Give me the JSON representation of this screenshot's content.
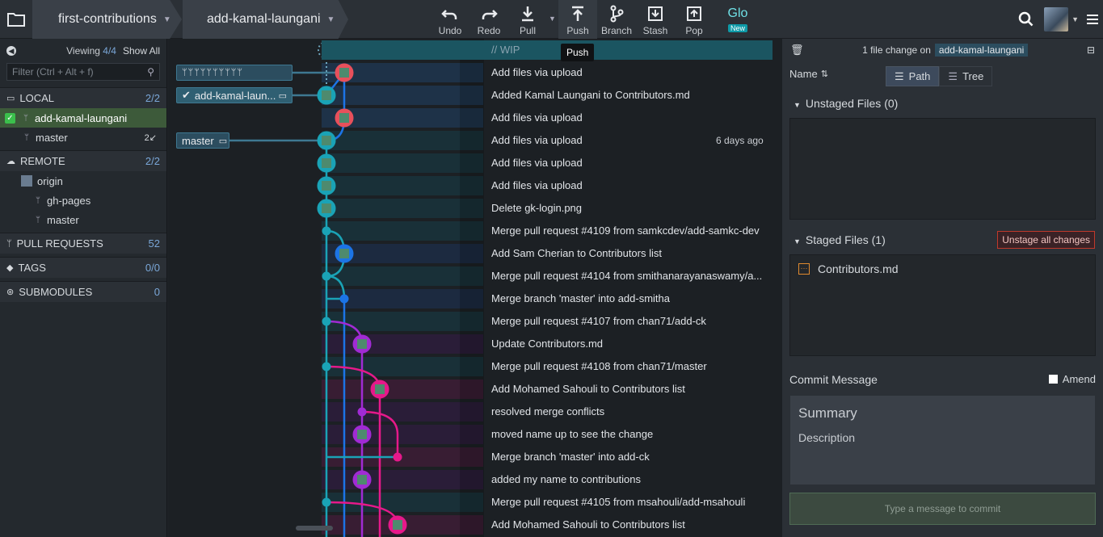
{
  "toolbar": {
    "repo": "first-contributions",
    "branch": "add-kamal-laungani",
    "buttons": [
      {
        "label": "Undo",
        "icon": "undo-icon"
      },
      {
        "label": "Redo",
        "icon": "redo-icon"
      },
      {
        "label": "Pull",
        "icon": "pull-icon"
      },
      {
        "label": "Push",
        "icon": "push-icon"
      },
      {
        "label": "Branch",
        "icon": "branch-icon"
      },
      {
        "label": "Stash",
        "icon": "stash-icon"
      },
      {
        "label": "Pop",
        "icon": "pop-icon"
      }
    ],
    "glo": "Glo",
    "glo_badge": "New",
    "tooltip": "Push"
  },
  "sidebar": {
    "viewing_label": "Viewing",
    "viewing_count": "4/4",
    "show_all": "Show All",
    "filter_placeholder": "Filter (Ctrl + Alt + f)",
    "local": {
      "label": "LOCAL",
      "count": "2/2"
    },
    "local_items": [
      {
        "label": "add-kamal-laungani",
        "badge": ""
      },
      {
        "label": "master",
        "badge": "2↙"
      }
    ],
    "remote": {
      "label": "REMOTE",
      "count": "2/2"
    },
    "remote_origin": "origin",
    "remote_items": [
      "gh-pages",
      "master"
    ],
    "pull_requests": {
      "label": "PULL REQUESTS",
      "count": "52"
    },
    "tags": {
      "label": "TAGS",
      "count": "0/0"
    },
    "submodules": {
      "label": "SUBMODULES",
      "count": "0"
    }
  },
  "graph": {
    "wip": "// WIP",
    "tags": {
      "branch_current": "add-kamal-laun...",
      "branch_master": "master"
    },
    "date_label": "6 days ago",
    "commits": [
      "Add files via upload",
      "Added Kamal Laungani to Contributors.md",
      "Add files via upload",
      "Add files via upload",
      "Add files via upload",
      "Add files via upload",
      "Delete gk-login.png",
      "Merge pull request #4109 from samkcdev/add-samkc-dev",
      "Add Sam Cherian to Contributors list",
      "Merge pull request #4104 from smithanarayanaswamy/a...",
      "Merge branch 'master' into add-smitha",
      "Merge pull request #4107 from chan71/add-ck",
      "Update Contributors.md",
      "Merge pull request #4108 from chan71/master",
      "Add Mohamed Sahouli to Contributors list",
      "resolved merge conflicts",
      "moved name up to see the change",
      "Merge branch 'master' into add-ck",
      "added my name to contributions",
      "Merge pull request #4105 from msahouli/add-msahouli",
      "Add Mohamed Sahouli to Contributors list"
    ]
  },
  "right_panel": {
    "change_summary": "1 file change on",
    "branch": "add-kamal-laungani",
    "sort_label": "Name",
    "view_path": "Path",
    "view_tree": "Tree",
    "unstaged": "Unstaged Files (0)",
    "staged": "Staged Files (1)",
    "unstage_all": "Unstage all changes",
    "staged_file": "Contributors.md",
    "commit_message_label": "Commit Message",
    "amend": "Amend",
    "summary_placeholder": "Summary",
    "description_placeholder": "Description",
    "commit_button": "Type a message to commit"
  },
  "colors": {
    "teal": "#1aa3b6",
    "blue": "#1c74e6",
    "purple": "#a12bd4",
    "magenta": "#e6198a",
    "accent_green": "#3d5a3a"
  }
}
